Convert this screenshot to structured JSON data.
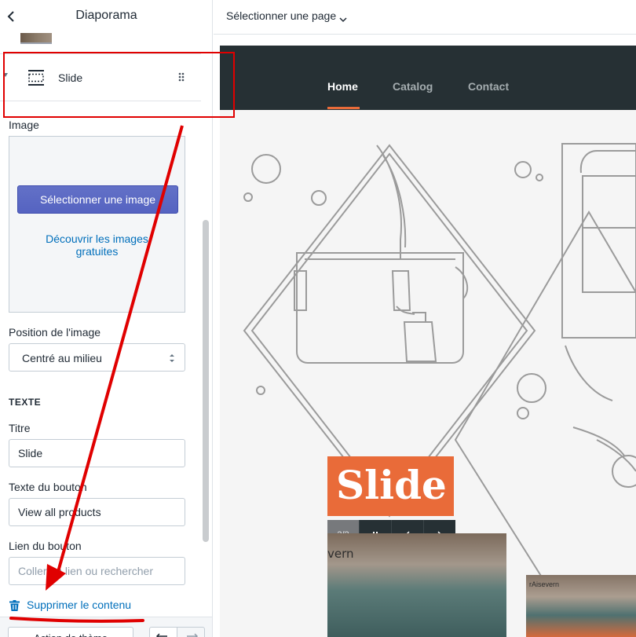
{
  "sidebar": {
    "title": "Diaporama",
    "slide_item": {
      "label": "Slide"
    },
    "image_field": {
      "label": "Image",
      "select_button": "Sélectionner une image",
      "free_images_link": "Découvrir les images gratuites"
    },
    "image_position": {
      "label": "Position de l'image",
      "value": "Centré au milieu"
    },
    "text_section": {
      "heading": "TEXTE",
      "title_label": "Titre",
      "title_value": "Slide",
      "button_text_label": "Texte du bouton",
      "button_text_value": "View all products",
      "button_link_label": "Lien du bouton",
      "button_link_placeholder": "Coller un lien ou rechercher"
    },
    "delete_label": "Supprimer le contenu",
    "footer": {
      "button_label": "Action de thème"
    }
  },
  "topbar": {
    "page_selector": "Sélectionner une page"
  },
  "preview": {
    "nav": [
      "Home",
      "Catalog",
      "Contact"
    ],
    "active_nav": "Home",
    "slide_title": "Slide",
    "slide_counter": "2/2",
    "photo_brand": "rAisevern",
    "photo_brand_partial": "vern",
    "colors": {
      "accent": "#e96b39",
      "nav_bg": "#263034",
      "annotation": "#e00000"
    }
  }
}
